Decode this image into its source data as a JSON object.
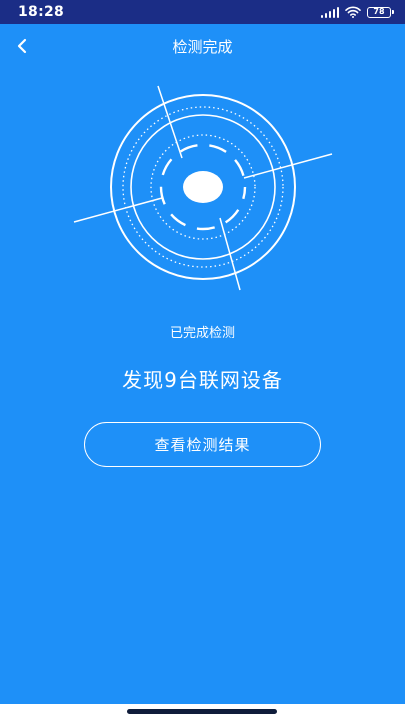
{
  "status_bar": {
    "time": "18:28",
    "battery": "78",
    "icons": [
      "signal-icon",
      "wifi-icon",
      "battery-icon"
    ]
  },
  "header": {
    "title": "检测完成",
    "back_icon": "chevron-left-icon"
  },
  "main": {
    "status_text": "已完成检测",
    "result_text": "发现9台联网设备",
    "button_label": "查看检测结果"
  },
  "colors": {
    "background": "#1E90F8",
    "status_bar_bg": "#1B2D86",
    "foreground": "#FFFFFF"
  }
}
